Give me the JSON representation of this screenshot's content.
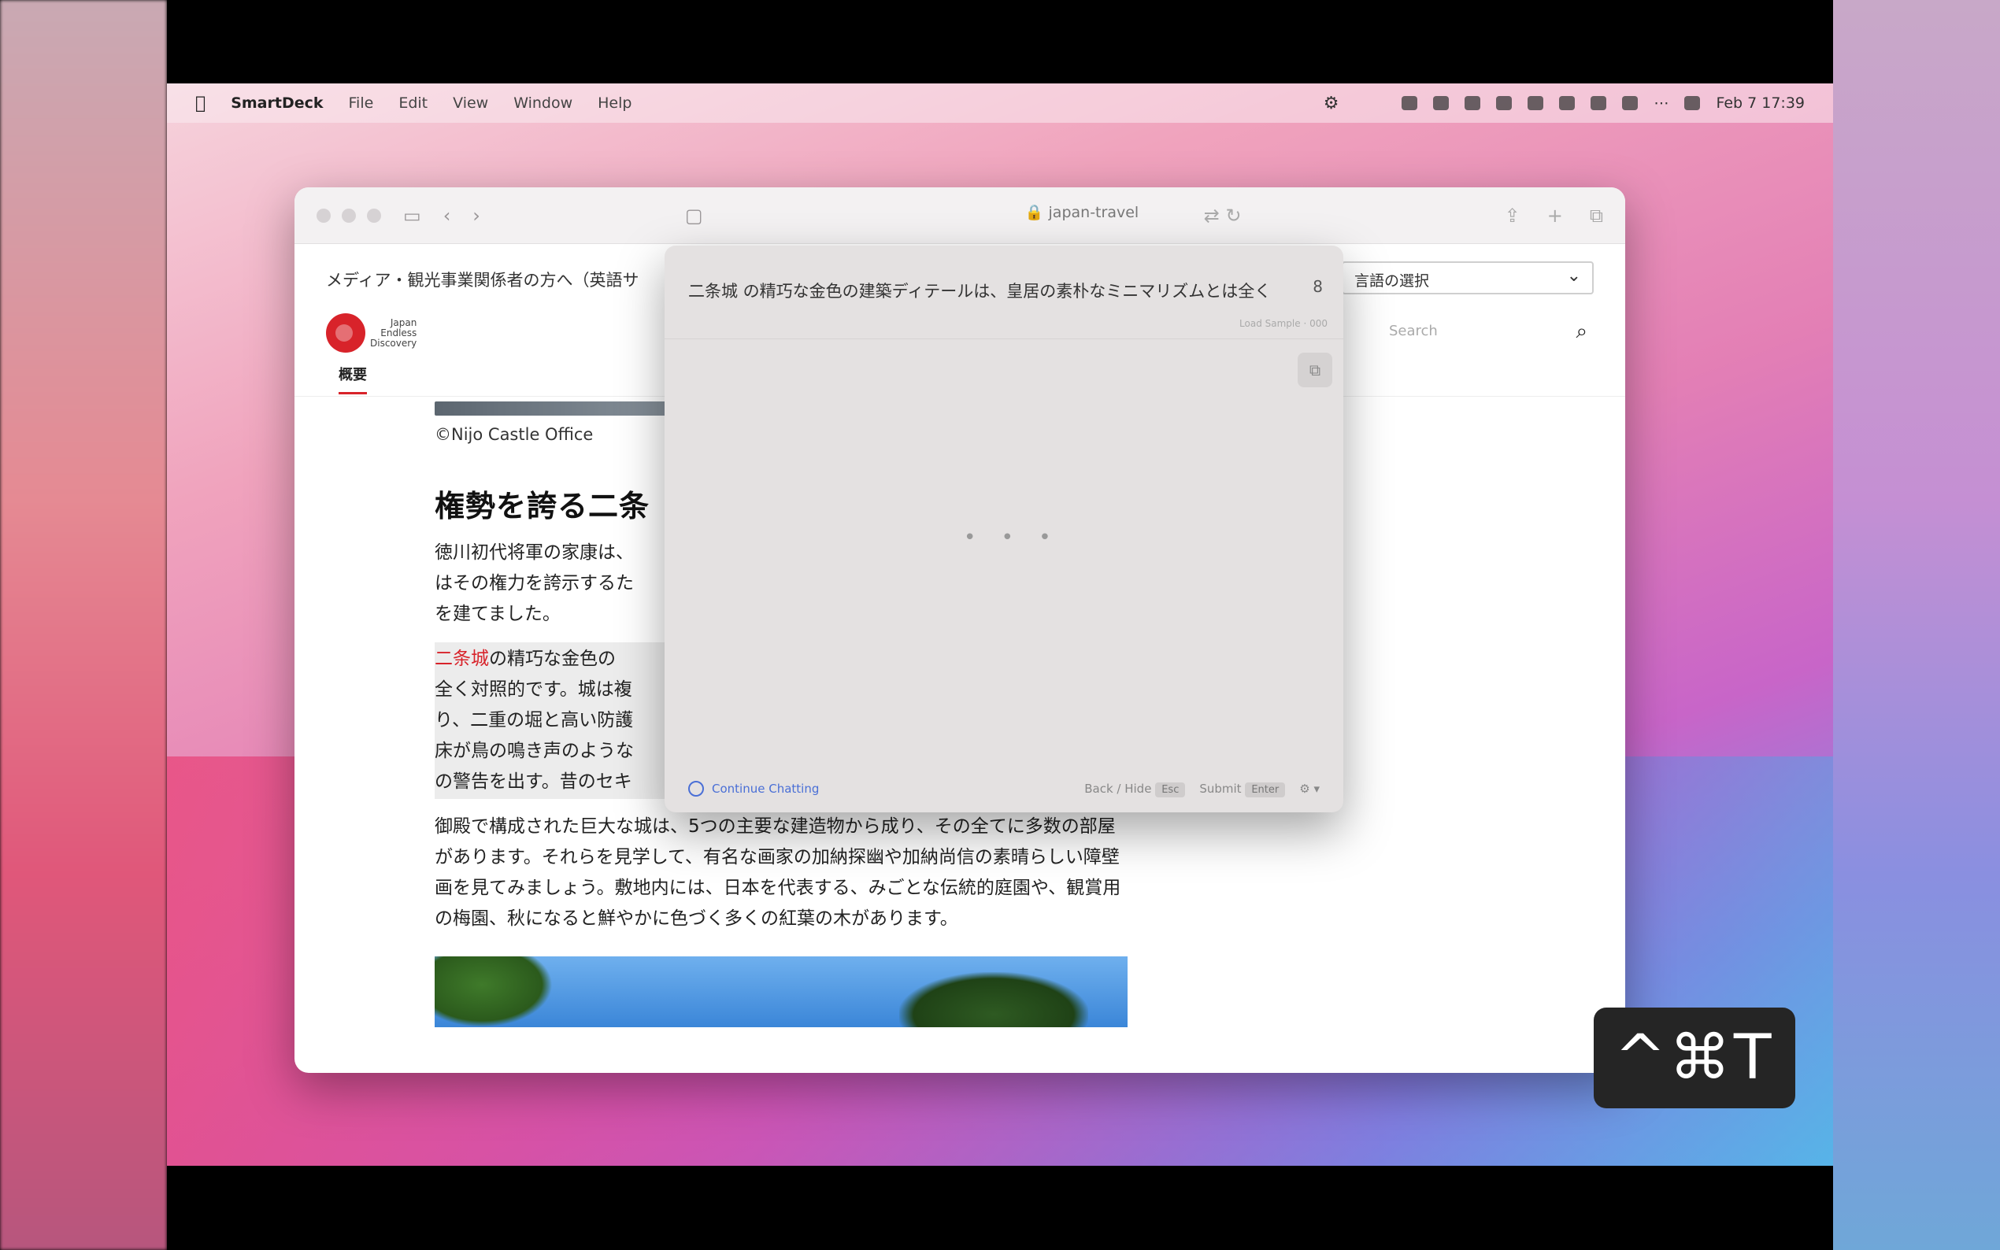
{
  "menubar": {
    "app_name": "SmartDeck",
    "items": [
      "File",
      "Edit",
      "View",
      "Window",
      "Help"
    ],
    "clock": "Feb 7  17:39"
  },
  "browser": {
    "address": "japan-travel"
  },
  "page": {
    "notice": "メディア・観光事業関係者の方へ（英語サ",
    "language_select": "言語の選択",
    "logo_text": [
      "Japan",
      "Endless",
      "Discovery"
    ],
    "search_placeholder": "Search",
    "tab_label": "概要",
    "caption": "©Nijo Castle Office",
    "heading": "権勢を誇る二条",
    "p1": "徳川初代将軍の家康は、\nはその権力を誇示するた\nを建てました。",
    "p2_keyword": "二条城",
    "p2_rest": "の精巧な金色の\n全く対照的です。城は複\nり、二重の堀と高い防護\n床が鳥の鳴き声のような\nの警告を出す。昔のセキ",
    "p3": "御殿で構成された巨大な城は、5つの主要な建造物から成り、その全てに多数の部屋があります。それらを見学して、有名な画家の加納探幽や加納尚信の素晴らしい障壁画を見てみましょう。敷地内には、日本を代表する、みごとな伝統的庭園や、観賞用の梅園、秋になると鮮やかに色づく多くの紅葉の木があります。"
  },
  "popup": {
    "source_text": "二条城 の精巧な金色の建築ディテールは、皇居の素朴なミニマリズムとは全く",
    "source_count": "8",
    "meta": "Load Sample · 000",
    "loading": "• • •",
    "continue_label": "Continue Chatting",
    "back_label": "Back / Hide",
    "back_key": "Esc",
    "submit_label": "Submit",
    "submit_key": "Enter"
  },
  "shortcut": "^⌘T",
  "colors": {
    "accent_red": "#d8232a",
    "link_blue": "#4a6fd6"
  }
}
